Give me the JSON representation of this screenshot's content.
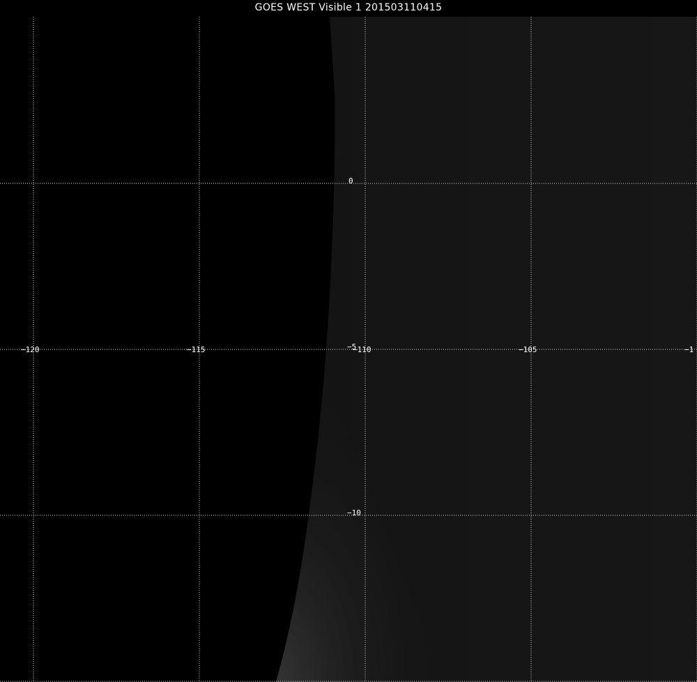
{
  "title": "GOES WEST Visible 1 201503110415",
  "graticule": {
    "longitudes": [
      {
        "value": -120,
        "label": "−120"
      },
      {
        "value": -115,
        "label": "−115"
      },
      {
        "value": -110,
        "label": "−110"
      },
      {
        "value": -105,
        "label": "−105"
      },
      {
        "value": -100,
        "label": "−1"
      }
    ],
    "latitudes": [
      {
        "value": 0,
        "label": "0"
      },
      {
        "value": -5,
        "label": "−5"
      },
      {
        "value": -10,
        "label": "−10"
      },
      {
        "value": -15,
        "label": ""
      }
    ],
    "line_color": "#d8d8d8",
    "label_color": "#ffffff",
    "style": "dotted"
  },
  "imagery": {
    "band": "Visible 1",
    "space_color": "#000000",
    "disk_color": "#151515",
    "limb_glow_color": "#2e2e2e"
  }
}
